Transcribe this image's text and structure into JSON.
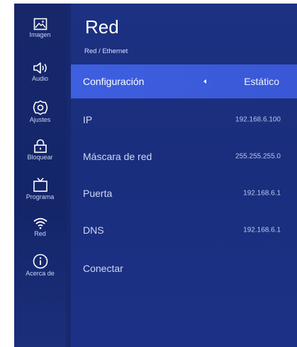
{
  "sidebar": {
    "items": [
      {
        "label": "Imagen",
        "icon": "image-icon"
      },
      {
        "label": "Audio",
        "icon": "speaker-icon"
      },
      {
        "label": "Ajustes",
        "icon": "settings-icon"
      },
      {
        "label": "Bloquear",
        "icon": "lock-icon"
      },
      {
        "label": "Programa",
        "icon": "tv-icon"
      },
      {
        "label": "Red",
        "icon": "wifi-icon"
      },
      {
        "label": "Acerca de",
        "icon": "info-icon"
      }
    ]
  },
  "header": {
    "title": "Red",
    "breadcrumb": "Red / Ethernet"
  },
  "settings": [
    {
      "label": "Configuración",
      "value": "Estático"
    },
    {
      "label": "IP",
      "value": "192.168.6.100"
    },
    {
      "label": "Máscara de red",
      "value": "255.255.255.0"
    },
    {
      "label": "Puerta",
      "value": "192.168.6.1"
    },
    {
      "label": "DNS",
      "value": "192.168.6.1"
    },
    {
      "label": "Conectar",
      "value": ""
    }
  ],
  "colors": {
    "background": "#17296e",
    "selected_row": "#3d5fe0"
  }
}
